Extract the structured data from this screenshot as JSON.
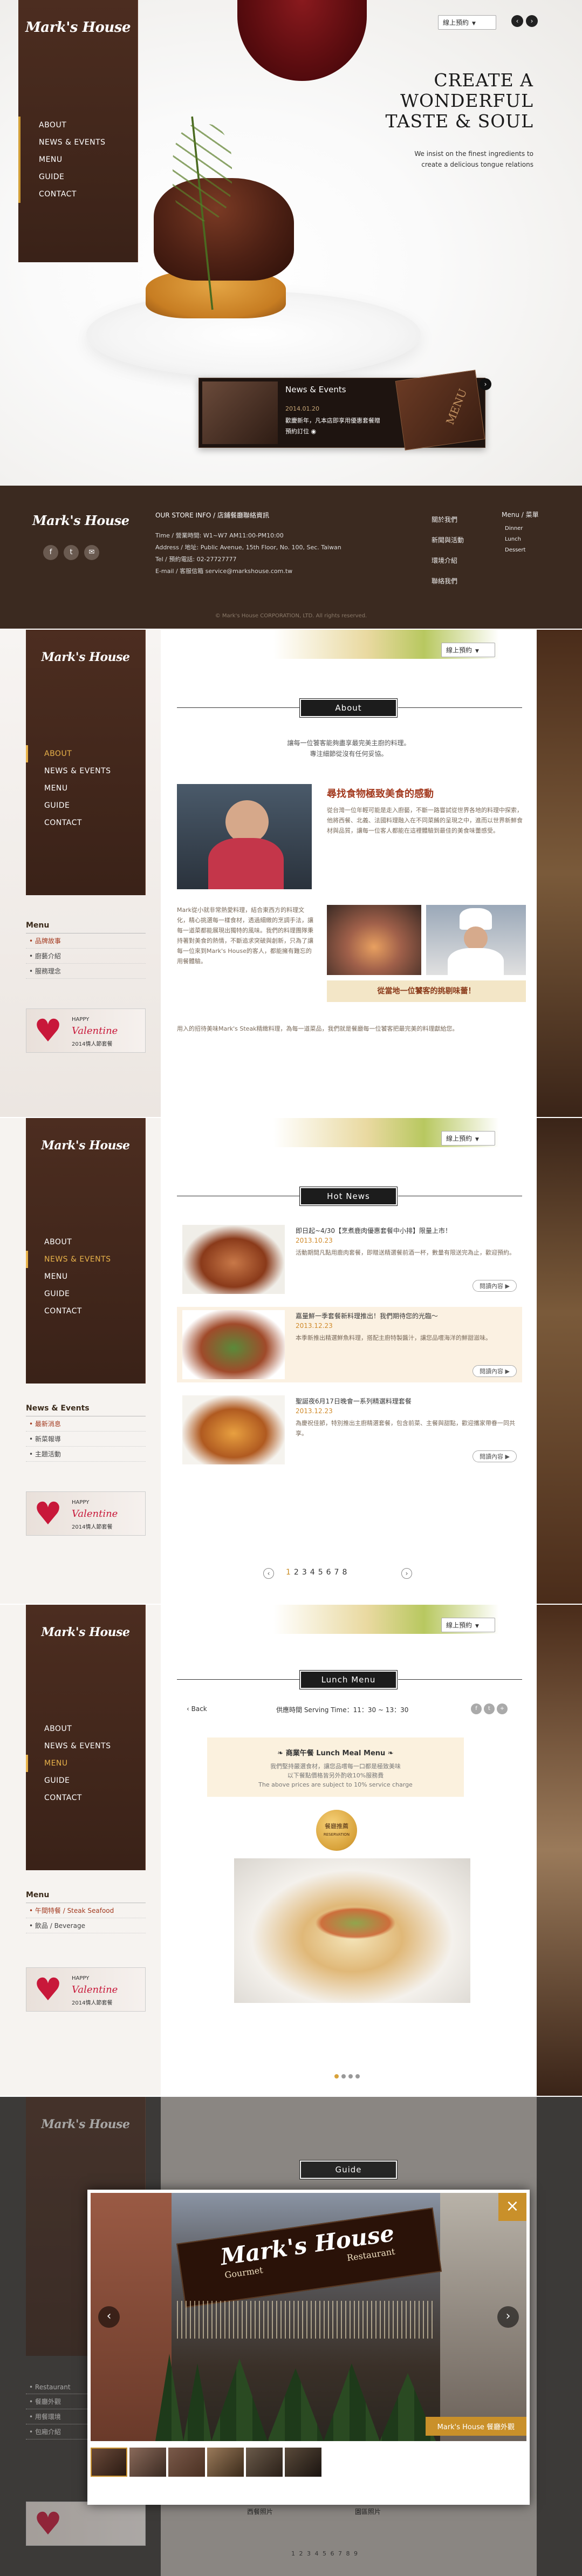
{
  "brand": {
    "logo": "Mark's House",
    "colors": {
      "accent": "#e8b24a",
      "dark_brown": "#3a2218",
      "red": "#a33a1f"
    }
  },
  "lang": "線上預約",
  "nav": [
    "ABOUT",
    "NEWS & EVENTS",
    "MENU",
    "GUIDE",
    "CONTACT"
  ],
  "hero": {
    "heading_1": "CREATE A",
    "heading_2": "WONDERFUL",
    "heading_3": "TASTE & SOUL",
    "tagline_1": "We insist on the finest ingredients to",
    "tagline_2": "create a delicious tongue relations",
    "news_title": "News & Events",
    "news_date": "2014.01.20",
    "news_text": "歡慶新年，凡本店即享用優惠套餐贈",
    "news_more": "預約訂位 ◉",
    "menu_word": "MENU"
  },
  "footer": {
    "store_heading": "OUR STORE INFO / 店鋪餐廳聯絡資訊",
    "time": "Time / 營業時間: W1~W7 AM11:00-PM10:00",
    "address": "Address / 地址: Public Avenue, 15th Floor, No. 100, Sec. Taiwan",
    "tel": "Tel / 預約電話: 02-27727777",
    "email": "E-mail / 客服信箱 service@markshouse.com.tw",
    "copyright": "© Mark's House CORPORATION, LTD. All rights reserved.",
    "col1": [
      "關於我們",
      "新聞與活動",
      "環境介紹",
      "聯絡我們"
    ],
    "col2_head": "Menu / 菜單",
    "col2": [
      "Dinner",
      "Lunch",
      "Dessert"
    ],
    "social": [
      "f",
      "t",
      "✉"
    ]
  },
  "about": {
    "title": "About",
    "intro_1": "讓每一位饕客能夠盡享最完美主廚的料理。",
    "intro_2": "專注細節從沒有任何妥協。",
    "headline": "尋找食物極致美食的感動",
    "p1": "從台灣一位年輕可能是走入廚藝，不斷一路嘗試從世界各地的料理中探索，他將西餐、北義、法國料理融入在不同菜餚的呈現之中，進而以世界新鮮食材與品質，讓每一位客人都能在這裡體驗到最佳的美食味蕾感受。",
    "p2": "Mark從小就非常熱愛料理，結合東西方的料理文化，精心挑選每一樣食材，透過細緻的烹調手法，讓每一道菜都能展現出獨特的風味。我們的料理團隊秉持著對美食的熱情，不斷追求突破與創新，只為了讓每一位來到Mark's House的客人，都能擁有難忘的用餐體驗。",
    "p3": "用入的招待美味Mark's Steak精緻料理，為每一道菜品，我們就是餐廳每一位饕客把最完美的料理獻給您。",
    "promo": "從當地一位饕客的挑剔味蕾！",
    "submenu_head": "Menu",
    "submenu": [
      "• 品牌故事",
      "• 廚藝介紹",
      "• 服務理念"
    ]
  },
  "news": {
    "title": "Hot News",
    "submenu_head": "News & Events",
    "submenu": [
      "• 最新消息",
      "• 新菜報導",
      "• 主題活動"
    ],
    "more": "閱讀內容 ▶",
    "items": [
      {
        "title": "即日起~4/30【烹煮鹿肉優惠套餐中小排】限量上市！",
        "date": "2013.10.23",
        "text": "活動期間凡點用鹿肉套餐，即贈送精選餐前酒一杯，數量有限送完為止，歡迎預約。"
      },
      {
        "title": "嘉量鮮一季套餐新料理推出！我們期待您的光臨～",
        "date": "2013.12.23",
        "text": "本季新推出精選鮮魚料理，搭配主廚特製醬汁，讓您品嚐海洋的鮮甜滋味。"
      },
      {
        "title": "聖誕夜6月17日晚會一系列精選料理套餐",
        "date": "2013.12.23",
        "text": "為慶祝佳節，特別推出主廚精選套餐，包含前菜、主餐與甜點，歡迎攜家帶眷一同共享。"
      }
    ],
    "pages": [
      "1",
      "2",
      "3",
      "4",
      "5",
      "6",
      "7",
      "8"
    ]
  },
  "lunch": {
    "title": "Lunch Menu",
    "back": "Back",
    "hours": "供應時間 Serving Time：11：30 ~ 13：30",
    "box_title": "❧ 商業午餐 Lunch Meal Menu ❧",
    "box_line1": "我們堅持嚴選食材，讓您品嚐每一口都是極致美味",
    "box_line2": "以下餐點價格皆另外酌收10%服務費",
    "box_line3": "The above prices are subject to 10% service charge",
    "badge_1": "餐廳推薦",
    "badge_2": "RESERVATION",
    "submenu_head": "Menu",
    "submenu": [
      "• 午間特餐 / Steak Seafood",
      "• 飲品 / Beverage"
    ]
  },
  "guide": {
    "title": "Guide",
    "photo_caption": "Mark's House 餐廳外觀",
    "thumb_label_1": "西餐照片",
    "thumb_label_2": "園區照片",
    "sign_1": "Mark's House",
    "sign_2": "Gourmet",
    "sign_3": "Restaurant",
    "submenu": [
      "• Restaurant",
      "• 餐廳外觀",
      "• 用餐環境",
      "• 包廂介紹"
    ],
    "pages": "1 2 3 4 5 6 7 8 9",
    "close": "×"
  },
  "vday": {
    "text_1": "HAPPY",
    "text_2": "Valentine",
    "text_3": "2014情人節套餐"
  }
}
